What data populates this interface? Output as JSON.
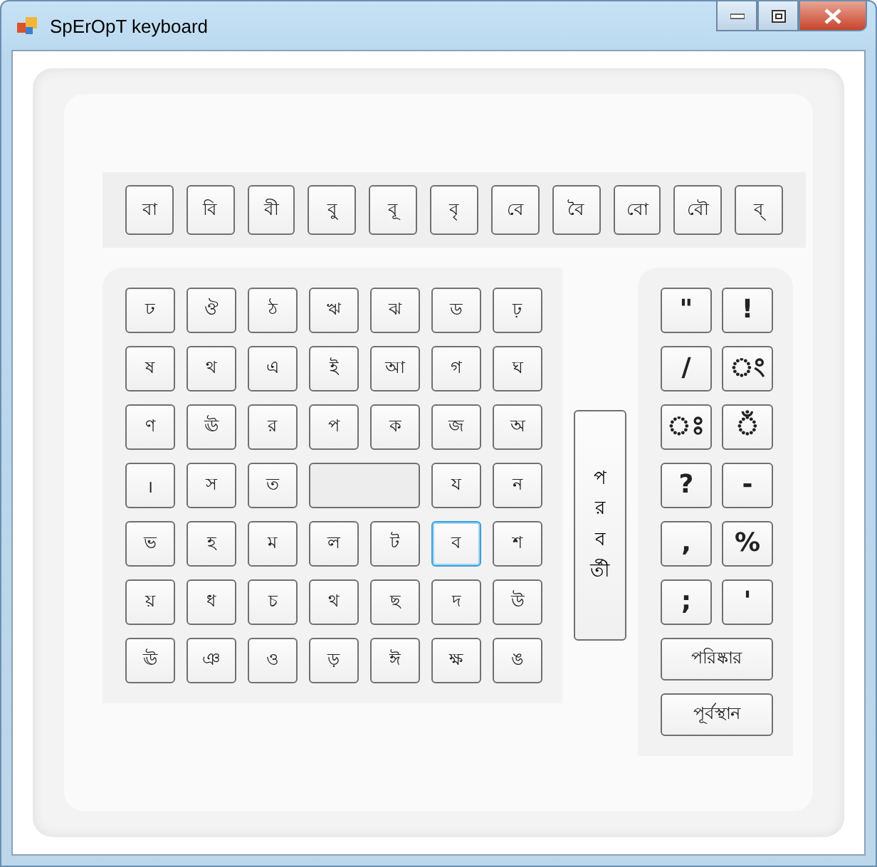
{
  "window": {
    "title": "SpErOpT keyboard"
  },
  "vowel_signs": [
    "বা",
    "বি",
    "বী",
    "বু",
    "বূ",
    "বৃ",
    "বে",
    "বৈ",
    "বো",
    "বৌ",
    "ব্"
  ],
  "letter_keys": [
    [
      {
        "label": "ঢ",
        "focused": false
      },
      {
        "label": "ঔ",
        "focused": false
      },
      {
        "label": "ঠ",
        "focused": false
      },
      {
        "label": "ঋ",
        "focused": false
      },
      {
        "label": "ঝ",
        "focused": false
      },
      {
        "label": "ড",
        "focused": false
      },
      {
        "label": "ঢ়",
        "focused": false
      }
    ],
    [
      {
        "label": "ষ",
        "focused": false
      },
      {
        "label": "থ",
        "focused": false
      },
      {
        "label": "এ",
        "focused": false
      },
      {
        "label": "ই",
        "focused": false
      },
      {
        "label": "আ",
        "focused": false
      },
      {
        "label": "গ",
        "focused": false
      },
      {
        "label": "ঘ",
        "focused": false
      }
    ],
    [
      {
        "label": "ণ",
        "focused": false
      },
      {
        "label": "ঊ",
        "focused": false
      },
      {
        "label": "র",
        "focused": false
      },
      {
        "label": "প",
        "focused": false
      },
      {
        "label": "ক",
        "focused": false
      },
      {
        "label": "জ",
        "focused": false
      },
      {
        "label": "অ",
        "focused": false
      }
    ],
    [
      {
        "label": "।",
        "focused": false
      },
      {
        "label": "স",
        "focused": false
      },
      {
        "label": "ত",
        "focused": false
      },
      {
        "kind": "space",
        "focused": false
      },
      {
        "label": "য",
        "focused": false
      },
      {
        "label": "ন",
        "focused": false
      }
    ],
    [
      {
        "label": "ভ",
        "focused": false
      },
      {
        "label": "হ",
        "focused": false
      },
      {
        "label": "ম",
        "focused": false
      },
      {
        "label": "ল",
        "focused": false
      },
      {
        "label": "ট",
        "focused": false
      },
      {
        "label": "ব",
        "focused": true
      },
      {
        "label": "শ",
        "focused": false
      }
    ],
    [
      {
        "label": "য়",
        "focused": false
      },
      {
        "label": "ধ",
        "focused": false
      },
      {
        "label": "চ",
        "focused": false
      },
      {
        "label": "থ",
        "focused": false
      },
      {
        "label": "ছ",
        "focused": false
      },
      {
        "label": "দ",
        "focused": false
      },
      {
        "label": "উ",
        "focused": false
      }
    ],
    [
      {
        "label": "ঊ",
        "focused": false
      },
      {
        "label": "ঞ",
        "focused": false
      },
      {
        "label": "ও",
        "focused": false
      },
      {
        "label": "ড়",
        "focused": false
      },
      {
        "label": "ঈ",
        "focused": false
      },
      {
        "label": "ক্ষ",
        "focused": false
      },
      {
        "label": "ঙ",
        "focused": false
      }
    ]
  ],
  "next_button": [
    "প",
    "র",
    "ব",
    "র্তী"
  ],
  "symbol_keys": [
    "\"",
    "!",
    "/",
    "ং",
    "ঃ",
    "ঁ",
    "?",
    "-",
    ",",
    "%",
    ";",
    "'"
  ],
  "action_buttons": [
    "পরিষ্কার",
    "পূর্বস্থান"
  ]
}
